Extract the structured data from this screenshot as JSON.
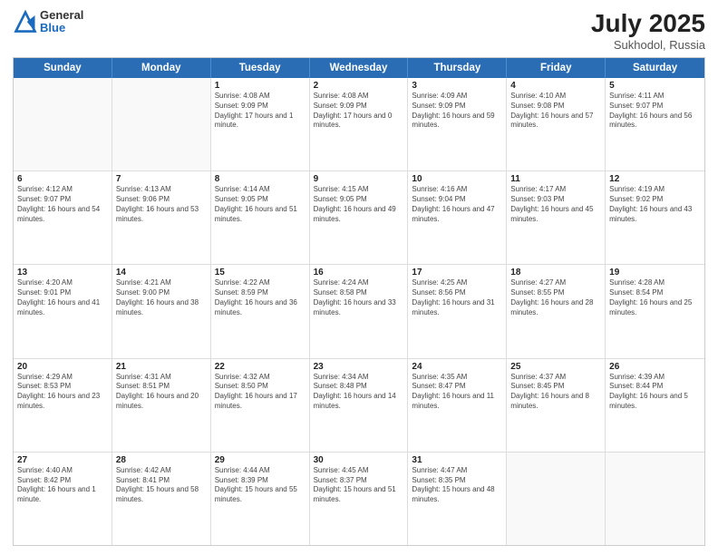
{
  "header": {
    "logo": {
      "general": "General",
      "blue": "Blue"
    },
    "title": "July 2025",
    "subtitle": "Sukhodol, Russia"
  },
  "days_of_week": [
    "Sunday",
    "Monday",
    "Tuesday",
    "Wednesday",
    "Thursday",
    "Friday",
    "Saturday"
  ],
  "weeks": [
    [
      {
        "day": "",
        "info": ""
      },
      {
        "day": "",
        "info": ""
      },
      {
        "day": "1",
        "info": "Sunrise: 4:08 AM\nSunset: 9:09 PM\nDaylight: 17 hours and 1 minute."
      },
      {
        "day": "2",
        "info": "Sunrise: 4:08 AM\nSunset: 9:09 PM\nDaylight: 17 hours and 0 minutes."
      },
      {
        "day": "3",
        "info": "Sunrise: 4:09 AM\nSunset: 9:09 PM\nDaylight: 16 hours and 59 minutes."
      },
      {
        "day": "4",
        "info": "Sunrise: 4:10 AM\nSunset: 9:08 PM\nDaylight: 16 hours and 57 minutes."
      },
      {
        "day": "5",
        "info": "Sunrise: 4:11 AM\nSunset: 9:07 PM\nDaylight: 16 hours and 56 minutes."
      }
    ],
    [
      {
        "day": "6",
        "info": "Sunrise: 4:12 AM\nSunset: 9:07 PM\nDaylight: 16 hours and 54 minutes."
      },
      {
        "day": "7",
        "info": "Sunrise: 4:13 AM\nSunset: 9:06 PM\nDaylight: 16 hours and 53 minutes."
      },
      {
        "day": "8",
        "info": "Sunrise: 4:14 AM\nSunset: 9:05 PM\nDaylight: 16 hours and 51 minutes."
      },
      {
        "day": "9",
        "info": "Sunrise: 4:15 AM\nSunset: 9:05 PM\nDaylight: 16 hours and 49 minutes."
      },
      {
        "day": "10",
        "info": "Sunrise: 4:16 AM\nSunset: 9:04 PM\nDaylight: 16 hours and 47 minutes."
      },
      {
        "day": "11",
        "info": "Sunrise: 4:17 AM\nSunset: 9:03 PM\nDaylight: 16 hours and 45 minutes."
      },
      {
        "day": "12",
        "info": "Sunrise: 4:19 AM\nSunset: 9:02 PM\nDaylight: 16 hours and 43 minutes."
      }
    ],
    [
      {
        "day": "13",
        "info": "Sunrise: 4:20 AM\nSunset: 9:01 PM\nDaylight: 16 hours and 41 minutes."
      },
      {
        "day": "14",
        "info": "Sunrise: 4:21 AM\nSunset: 9:00 PM\nDaylight: 16 hours and 38 minutes."
      },
      {
        "day": "15",
        "info": "Sunrise: 4:22 AM\nSunset: 8:59 PM\nDaylight: 16 hours and 36 minutes."
      },
      {
        "day": "16",
        "info": "Sunrise: 4:24 AM\nSunset: 8:58 PM\nDaylight: 16 hours and 33 minutes."
      },
      {
        "day": "17",
        "info": "Sunrise: 4:25 AM\nSunset: 8:56 PM\nDaylight: 16 hours and 31 minutes."
      },
      {
        "day": "18",
        "info": "Sunrise: 4:27 AM\nSunset: 8:55 PM\nDaylight: 16 hours and 28 minutes."
      },
      {
        "day": "19",
        "info": "Sunrise: 4:28 AM\nSunset: 8:54 PM\nDaylight: 16 hours and 25 minutes."
      }
    ],
    [
      {
        "day": "20",
        "info": "Sunrise: 4:29 AM\nSunset: 8:53 PM\nDaylight: 16 hours and 23 minutes."
      },
      {
        "day": "21",
        "info": "Sunrise: 4:31 AM\nSunset: 8:51 PM\nDaylight: 16 hours and 20 minutes."
      },
      {
        "day": "22",
        "info": "Sunrise: 4:32 AM\nSunset: 8:50 PM\nDaylight: 16 hours and 17 minutes."
      },
      {
        "day": "23",
        "info": "Sunrise: 4:34 AM\nSunset: 8:48 PM\nDaylight: 16 hours and 14 minutes."
      },
      {
        "day": "24",
        "info": "Sunrise: 4:35 AM\nSunset: 8:47 PM\nDaylight: 16 hours and 11 minutes."
      },
      {
        "day": "25",
        "info": "Sunrise: 4:37 AM\nSunset: 8:45 PM\nDaylight: 16 hours and 8 minutes."
      },
      {
        "day": "26",
        "info": "Sunrise: 4:39 AM\nSunset: 8:44 PM\nDaylight: 16 hours and 5 minutes."
      }
    ],
    [
      {
        "day": "27",
        "info": "Sunrise: 4:40 AM\nSunset: 8:42 PM\nDaylight: 16 hours and 1 minute."
      },
      {
        "day": "28",
        "info": "Sunrise: 4:42 AM\nSunset: 8:41 PM\nDaylight: 15 hours and 58 minutes."
      },
      {
        "day": "29",
        "info": "Sunrise: 4:44 AM\nSunset: 8:39 PM\nDaylight: 15 hours and 55 minutes."
      },
      {
        "day": "30",
        "info": "Sunrise: 4:45 AM\nSunset: 8:37 PM\nDaylight: 15 hours and 51 minutes."
      },
      {
        "day": "31",
        "info": "Sunrise: 4:47 AM\nSunset: 8:35 PM\nDaylight: 15 hours and 48 minutes."
      },
      {
        "day": "",
        "info": ""
      },
      {
        "day": "",
        "info": ""
      }
    ]
  ]
}
